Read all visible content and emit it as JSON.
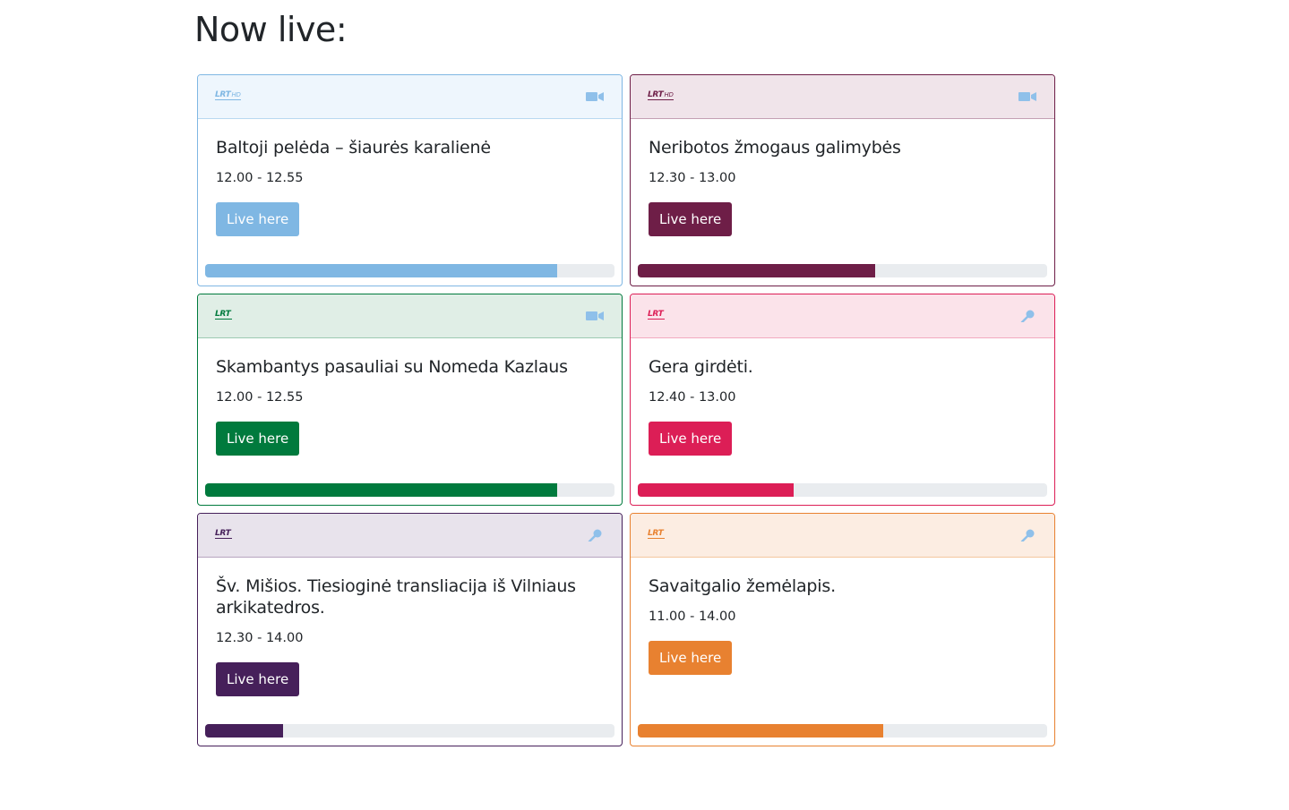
{
  "page": {
    "title": "Now live:"
  },
  "cards": [
    {
      "logo": "LRT",
      "logo_suffix": "HD",
      "media_icon": "video-camera-icon",
      "title": "Baltoji pelėda – šiaurės karalienė",
      "time": "12.00 - 12.55",
      "button_label": "Live here",
      "progress": 0.86,
      "accent": "#7fb7e3",
      "accent_light": "#b9d9f0",
      "tint": "#eef6fd"
    },
    {
      "logo": "LRT",
      "logo_suffix": "HD",
      "media_icon": "video-camera-icon",
      "title": "Neribotos žmogaus galimybės",
      "time": "12.30 - 13.00",
      "button_label": "Live here",
      "progress": 0.58,
      "accent": "#6e1e47",
      "accent_light": "#c4a0b3",
      "tint": "#f0e4ea"
    },
    {
      "logo": "LRT",
      "logo_suffix": "",
      "media_icon": "video-camera-icon",
      "title": "Skambantys pasauliai su Nomeda Kazlaus",
      "time": "12.00 - 12.55",
      "button_label": "Live here",
      "progress": 0.86,
      "accent": "#007a3d",
      "accent_light": "#9ccab2",
      "tint": "#e0eee6"
    },
    {
      "logo": "LRT",
      "logo_suffix": "",
      "media_icon": "microphone-icon",
      "title": "Gera girdėti.",
      "time": "12.40 - 13.00",
      "button_label": "Live here",
      "progress": 0.38,
      "accent": "#dc1e56",
      "accent_light": "#f2aac0",
      "tint": "#fbe3ea"
    },
    {
      "logo": "LRT",
      "logo_suffix": "",
      "media_icon": "microphone-icon",
      "title": "Šv. Mišios. Tiesioginė transliacija iš Vilniaus arkikatedros.",
      "time": "12.30 - 14.00",
      "button_label": "Live here",
      "progress": 0.19,
      "accent": "#46205a",
      "accent_light": "#b7a5c0",
      "tint": "#e8e3ec"
    },
    {
      "logo": "LRT",
      "logo_suffix": "",
      "media_icon": "microphone-icon",
      "title": "Savaitgalio žemėlapis.",
      "time": "11.00 - 14.00",
      "button_label": "Live here",
      "progress": 0.6,
      "accent": "#e88130",
      "accent_light": "#f4c79e",
      "tint": "#fcede2"
    }
  ],
  "icons": {
    "video-camera-icon": "#8fc0ea",
    "microphone-icon": "#8fc0ea"
  }
}
